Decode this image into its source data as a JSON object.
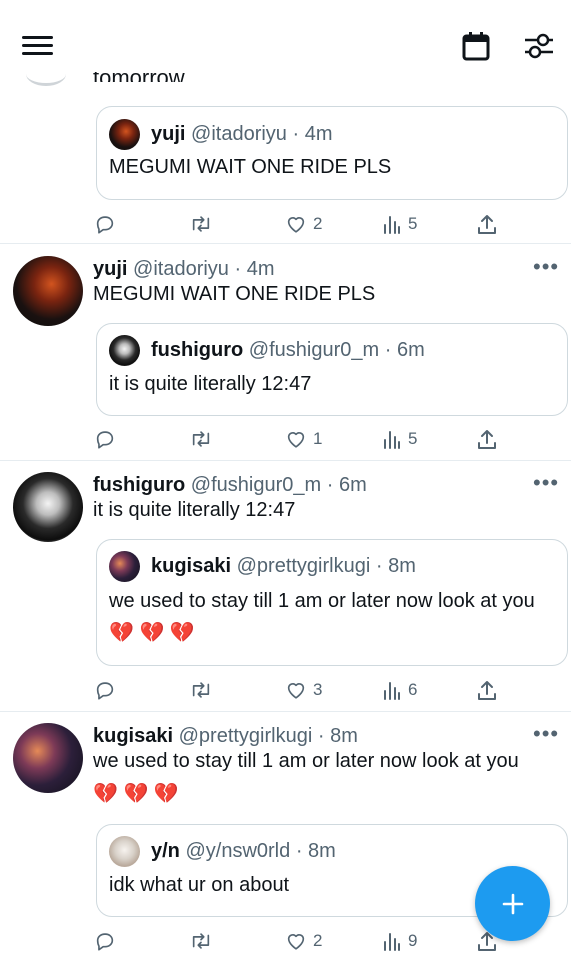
{
  "header": {
    "menu_icon": "hamburger-icon",
    "calendar_icon": "calendar-icon",
    "filter_icon": "sliders-icon"
  },
  "peek": {
    "text": "tomorrow"
  },
  "tweets": [
    {
      "quote": {
        "name": "yuji",
        "handle": "@itadoriyu",
        "time": "4m",
        "text": "MEGUMI WAIT ONE RIDE PLS"
      },
      "stats": {
        "replies": "",
        "retweets": "",
        "likes": "2",
        "views": "5"
      }
    },
    {
      "name": "yuji",
      "handle": "@itadoriyu",
      "time": "4m",
      "text": "MEGUMI WAIT ONE RIDE PLS",
      "quote": {
        "name": "fushiguro",
        "handle": "@fushigur0_m",
        "time": "6m",
        "text": "it is quite literally 12:47"
      },
      "stats": {
        "replies": "",
        "retweets": "",
        "likes": "1",
        "views": "5"
      }
    },
    {
      "name": "fushiguro",
      "handle": "@fushigur0_m",
      "time": "6m",
      "text": "it is quite literally 12:47",
      "quote": {
        "name": "kugisaki",
        "handle": "@prettygirlkugi",
        "time": "8m",
        "text": "we used to stay till 1 am or later now look at you 💔 💔 💔"
      },
      "stats": {
        "replies": "",
        "retweets": "",
        "likes": "3",
        "views": "6"
      }
    },
    {
      "name": "kugisaki",
      "handle": "@prettygirlkugi",
      "time": "8m",
      "text": "we used to stay till 1 am or later now look at you 💔 💔 💔",
      "quote": {
        "name": "y/n",
        "handle": "@y/nsw0rld",
        "time": "8m",
        "text": "idk what ur on about"
      },
      "stats": {
        "replies": "",
        "retweets": "",
        "likes": "2",
        "views": "9"
      }
    }
  ],
  "separator": "·",
  "more_label": "•••",
  "fab": {
    "icon": "plus-icon",
    "color": "#1d9bf0"
  }
}
